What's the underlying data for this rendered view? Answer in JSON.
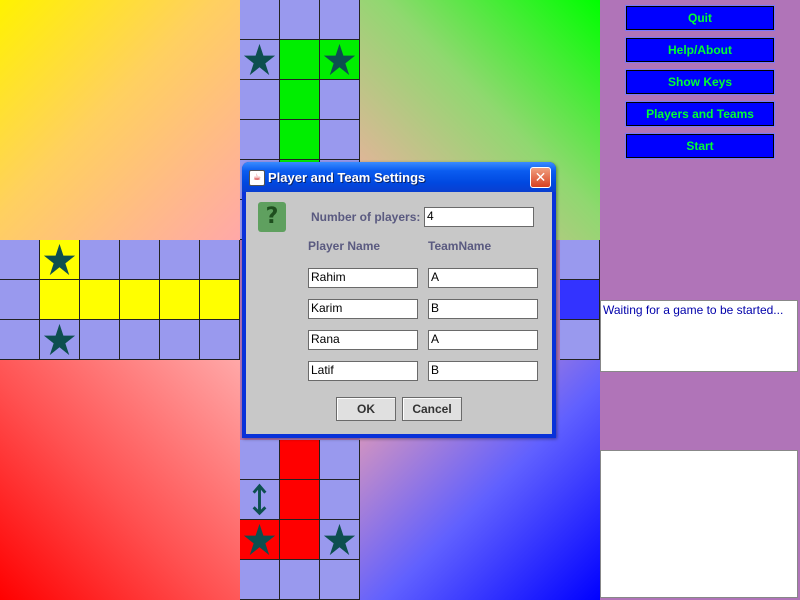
{
  "side_menu": {
    "quit": "Quit",
    "help": "Help/About",
    "show_keys": "Show Keys",
    "players_teams": "Players and Teams",
    "start": "Start"
  },
  "status": {
    "message": "Waiting for a game to be started..."
  },
  "dialog": {
    "title": "Player and Team Settings",
    "close_glyph": "✕",
    "question_glyph": "?",
    "num_players_label": "Number of players:",
    "num_players_value": "4",
    "player_name_header": "Player Name",
    "team_name_header": "TeamName",
    "players": [
      {
        "name": "Rahim",
        "team": "A"
      },
      {
        "name": "Karim",
        "team": "B"
      },
      {
        "name": "Rana",
        "team": "A"
      },
      {
        "name": "Latif",
        "team": "B"
      }
    ],
    "ok_label": "OK",
    "cancel_label": "Cancel"
  },
  "board": {
    "colors": {
      "yellow": "#ffff00",
      "green": "#00ee00",
      "red": "#ff0000",
      "blue": "#3333ff",
      "track": "#9999ee"
    },
    "icons": [
      "star-icon",
      "arrow-icon"
    ]
  }
}
